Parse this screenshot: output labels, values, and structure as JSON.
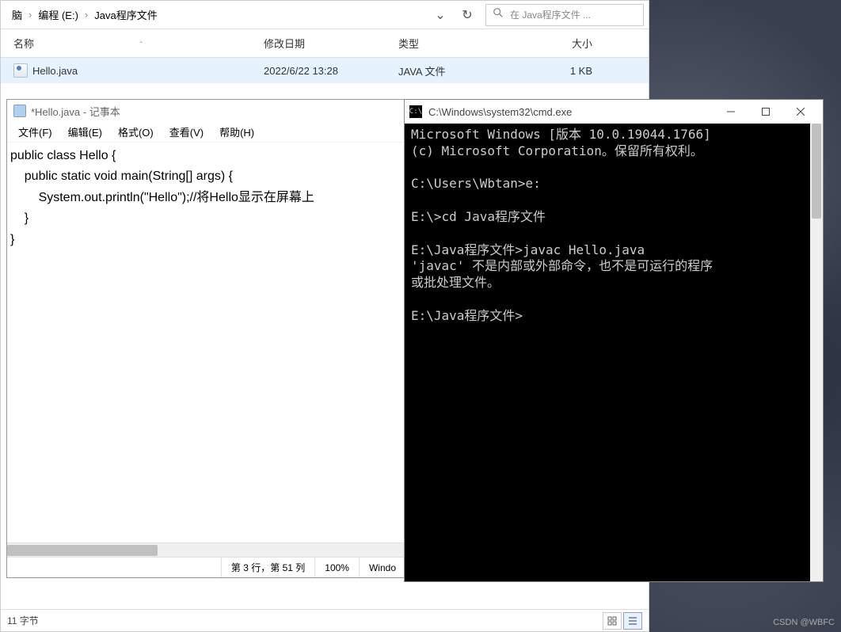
{
  "explorer": {
    "breadcrumb": [
      "脑",
      "编程 (E:)",
      "Java程序文件"
    ],
    "search_placeholder": "在 Java程序文件 ...",
    "columns": {
      "name": "名称",
      "date": "修改日期",
      "type": "类型",
      "size": "大小"
    },
    "files": [
      {
        "name": "Hello.java",
        "date": "2022/6/22 13:28",
        "type": "JAVA 文件",
        "size": "1 KB"
      }
    ],
    "status": "11 字节"
  },
  "notepad": {
    "title": "*Hello.java - 记事本",
    "menu": [
      "文件(F)",
      "编辑(E)",
      "格式(O)",
      "查看(V)",
      "帮助(H)"
    ],
    "content": "public class Hello {\n    public static void main(String[] args) {\n        System.out.println(\"Hello\");//将Hello显示在屏幕上\n    }\n}",
    "status_pos": "第 3 行，第 51 列",
    "status_zoom": "100%",
    "status_eol": "Windo"
  },
  "cmd": {
    "title": "C:\\Windows\\system32\\cmd.exe",
    "content": "Microsoft Windows [版本 10.0.19044.1766]\n(c) Microsoft Corporation。保留所有权利。\n\nC:\\Users\\Wbtan>e:\n\nE:\\>cd Java程序文件\n\nE:\\Java程序文件>javac Hello.java\n'javac' 不是内部或外部命令，也不是可运行的程序\n或批处理文件。\n\nE:\\Java程序文件>"
  },
  "watermark": "CSDN @WBFC"
}
